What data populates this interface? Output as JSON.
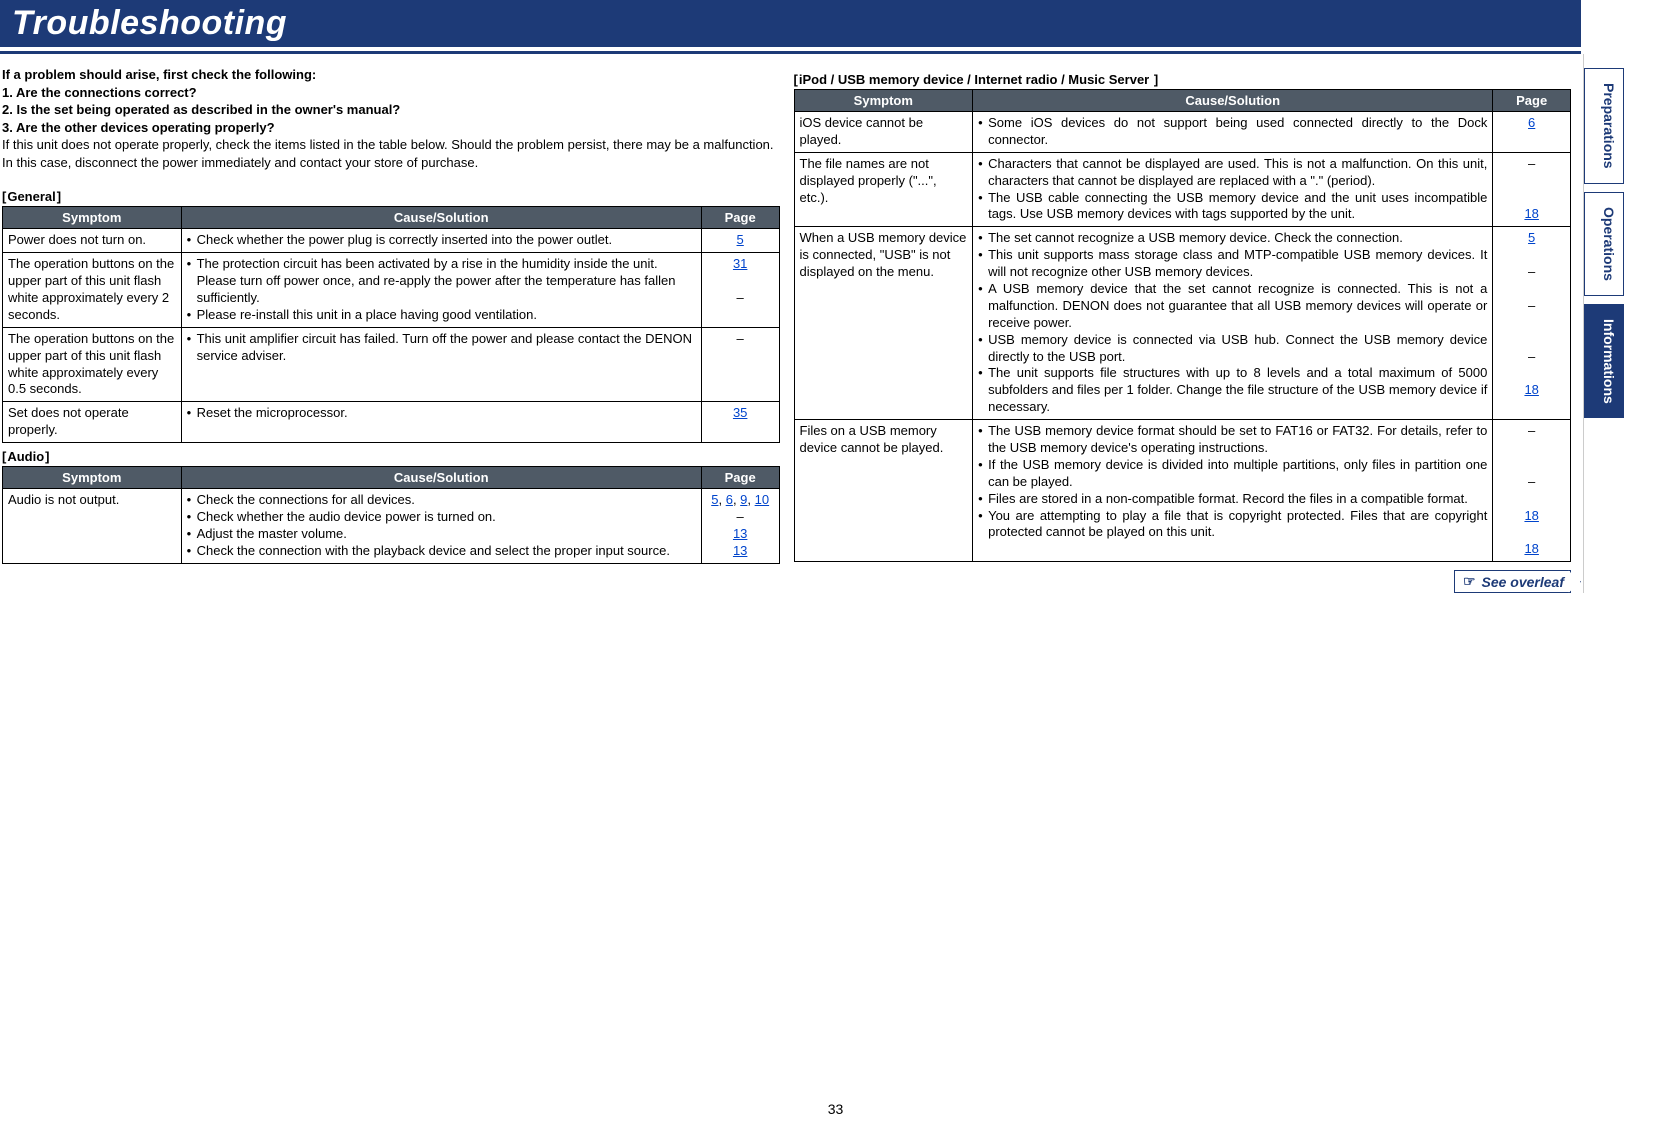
{
  "title": "Troubleshooting",
  "intro": {
    "heading": "If a problem should arise, first check the following:",
    "checks": [
      "1. Are the connections correct?",
      "2. Is the set being operated as described in the owner's manual?",
      "3. Are the other devices operating properly?"
    ],
    "body": "If this unit does not operate properly, check the items listed in the table below. Should the problem persist, there may be a malfunction.\nIn this case, disconnect the power immediately and contact your store of purchase."
  },
  "sections": {
    "general": {
      "label": "General",
      "head": {
        "symptom": "Symptom",
        "cause": "Cause/Solution",
        "page": "Page"
      },
      "rows": [
        {
          "symptom": "Power does not turn on.",
          "bullets": [
            "Check whether the power plug is correctly inserted into the power outlet."
          ],
          "pages": [
            {
              "t": "5",
              "link": true
            }
          ]
        },
        {
          "symptom": "The operation buttons on the upper part of this unit flash white approximately every 2 seconds.",
          "bullets": [
            "The protection circuit has been activated by a rise in the humidity inside the unit. Please turn off power once, and re-apply the power after the temperature has fallen sufficiently.",
            "Please re-install this unit in a place having good ventilation."
          ],
          "pages": [
            {
              "t": "31",
              "link": true
            },
            {
              "t": "",
              "link": false
            },
            {
              "t": "–",
              "link": false
            }
          ]
        },
        {
          "symptom": "The operation buttons on the upper part of this unit flash white approximately every 0.5 seconds.",
          "bullets": [
            "This unit amplifier circuit has failed. Turn off the power and please contact the DENON service adviser."
          ],
          "pages": [
            {
              "t": "–",
              "link": false
            }
          ]
        },
        {
          "symptom": "Set does not operate properly.",
          "bullets": [
            "Reset the microprocessor."
          ],
          "pages": [
            {
              "t": "35",
              "link": true
            }
          ]
        }
      ]
    },
    "audio": {
      "label": "Audio",
      "head": {
        "symptom": "Symptom",
        "cause": "Cause/Solution",
        "page": "Page"
      },
      "rows": [
        {
          "symptom": "Audio is not output.",
          "bullets": [
            "Check the connections for all devices.",
            "Check whether the audio device power is turned on.",
            "Adjust the master volume.",
            "Check the connection with the playback device and select the proper input source."
          ],
          "pages": [
            {
              "multi": [
                {
                  "t": "5",
                  "link": true
                },
                {
                  "t": ", "
                },
                {
                  "t": "6",
                  "link": true
                },
                {
                  "t": ", "
                },
                {
                  "t": "9",
                  "link": true
                },
                {
                  "t": ", "
                },
                {
                  "t": "10",
                  "link": true
                }
              ]
            },
            {
              "t": "–",
              "link": false
            },
            {
              "t": "13",
              "link": true
            },
            {
              "t": "13",
              "link": true
            }
          ]
        }
      ]
    },
    "ipod": {
      "label": "iPod / USB memory device / Internet radio / Music Server ",
      "head": {
        "symptom": "Symptom",
        "cause": "Cause/Solution",
        "page": "Page"
      },
      "rows": [
        {
          "symptom": "iOS device cannot be played.",
          "bullets": [
            "Some iOS devices do not support being used connected directly to the Dock connector."
          ],
          "pages": [
            {
              "t": "6",
              "link": true
            }
          ]
        },
        {
          "symptom": "The file names are not displayed properly (\"...\", etc.).",
          "bullets": [
            "Characters that cannot be displayed are used. This is not a malfunction. On this unit, characters that cannot be displayed are replaced with a \".\" (period).",
            "The USB cable connecting the USB memory device and the unit uses incompatible tags. Use USB memory devices with tags supported by the unit."
          ],
          "pages": [
            {
              "t": "–",
              "link": false
            },
            {
              "t": "",
              "link": false
            },
            {
              "t": "",
              "link": false
            },
            {
              "t": "18",
              "link": true
            }
          ]
        },
        {
          "symptom": "When a USB memory device is connected, \"USB\" is not displayed on the menu.",
          "bullets": [
            "The set cannot recognize a USB memory device. Check the connection.",
            "This unit supports mass storage class and MTP-compatible USB memory devices. It will not recognize other USB memory devices.",
            "A USB memory device that the set cannot recognize is connected. This is not a malfunction. DENON does not guarantee that all USB memory devices will operate or receive power.",
            "USB memory device is connected via USB hub. Connect the USB memory device directly to the USB port.",
            "The unit supports file structures with up to 8 levels and a total maximum of 5000 subfolders and files per 1 folder. Change the file structure of the USB memory device if necessary."
          ],
          "pages": [
            {
              "t": "5",
              "link": true
            },
            {
              "t": "",
              "link": false
            },
            {
              "t": "–",
              "link": false
            },
            {
              "t": "",
              "link": false
            },
            {
              "t": "–",
              "link": false
            },
            {
              "t": "",
              "link": false
            },
            {
              "t": "",
              "link": false
            },
            {
              "t": "–",
              "link": false
            },
            {
              "t": "",
              "link": false
            },
            {
              "t": "18",
              "link": true
            }
          ]
        },
        {
          "symptom": "Files on a USB memory device cannot be played.",
          "bullets": [
            "The USB memory device format should be set to FAT16 or FAT32. For details, refer to the USB memory device's operating instructions.",
            "If the USB memory device is divided into multiple partitions, only files in partition one can be played.",
            "Files are stored in a non-compatible format. Record the files in a compatible format.",
            "You are attempting to play a file that is copyright protected. Files that are copyright protected cannot be played on this unit."
          ],
          "pages": [
            {
              "t": "–",
              "link": false
            },
            {
              "t": "",
              "link": false
            },
            {
              "t": "",
              "link": false
            },
            {
              "t": "–",
              "link": false
            },
            {
              "t": "",
              "link": false
            },
            {
              "t": "18",
              "link": true
            },
            {
              "t": "",
              "link": false
            },
            {
              "t": "18",
              "link": true
            }
          ]
        }
      ]
    }
  },
  "see_overleaf": "See overleaf",
  "page_number": "33",
  "tabs": {
    "preparations": "Preparations",
    "operations": "Operations",
    "informations": "Informations"
  }
}
